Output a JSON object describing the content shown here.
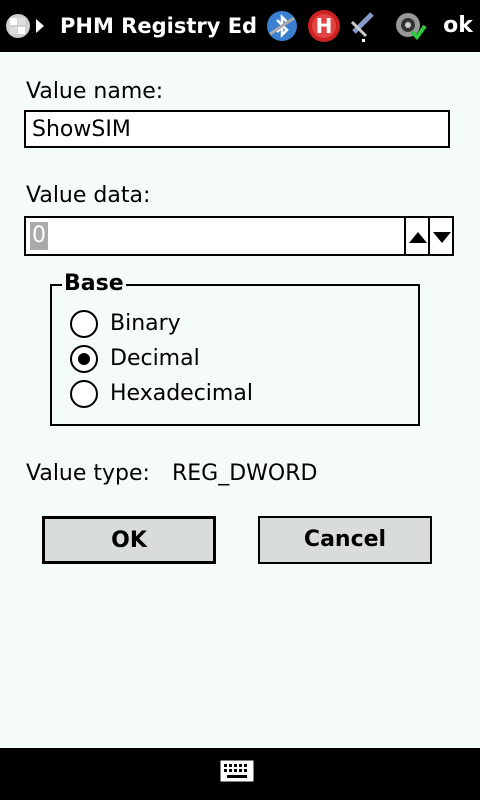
{
  "titlebar": {
    "title": "PHM Registry Editor",
    "ok_label": "ok",
    "icons": [
      "windows-start-icon",
      "bluetooth-icon",
      "h-network-icon",
      "signal-antenna-icon",
      "speaker-icon"
    ]
  },
  "form": {
    "value_name_label": "Value name:",
    "value_name": "ShowSIM",
    "value_data_label": "Value data:",
    "value_data": "0",
    "base": {
      "title": "Base",
      "options": [
        {
          "label": "Binary",
          "selected": false
        },
        {
          "label": "Decimal",
          "selected": true
        },
        {
          "label": "Hexadecimal",
          "selected": false
        }
      ]
    },
    "value_type_label": "Value type:",
    "value_type": "REG_DWORD"
  },
  "buttons": {
    "ok": "OK",
    "cancel": "Cancel"
  },
  "colors": {
    "background": "#f5fbf8",
    "bar": "#000000",
    "button_face": "#d8dcdb",
    "h_icon_red": "#cc2222"
  }
}
